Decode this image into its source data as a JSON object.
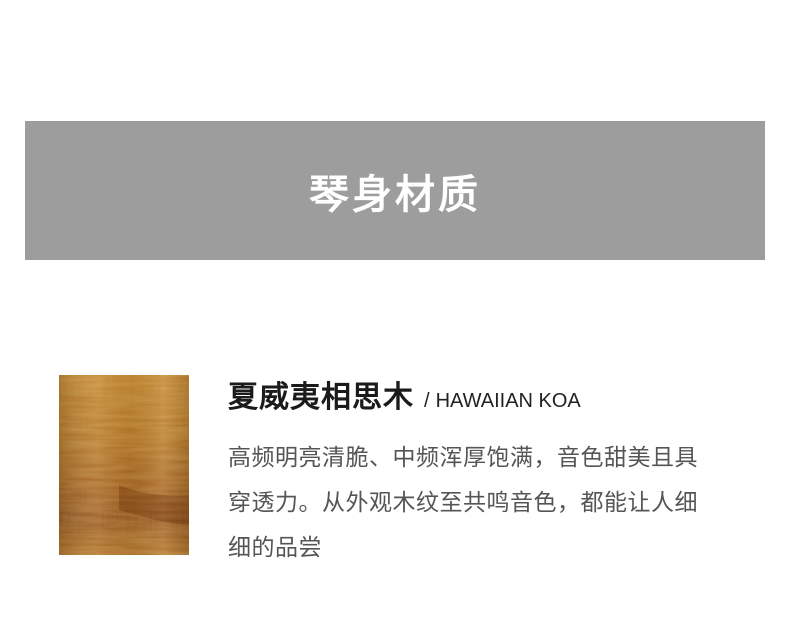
{
  "banner": {
    "title": "琴身材质",
    "background": "#9d9d9d"
  },
  "material": {
    "name_cn": "夏威夷相思木",
    "separator": "/",
    "name_en": "HAWAIIAN KOA",
    "desc_lines": [
      "高频明亮清脆、中频浑厚饱满，音色甜美且具",
      "穿透力。从外观木纹至共鸣音色，都能让人细",
      "细的品尝"
    ],
    "swatch_colors": [
      "#c9831f",
      "#9a4f10",
      "#7a3a0c",
      "#e2a548"
    ]
  }
}
